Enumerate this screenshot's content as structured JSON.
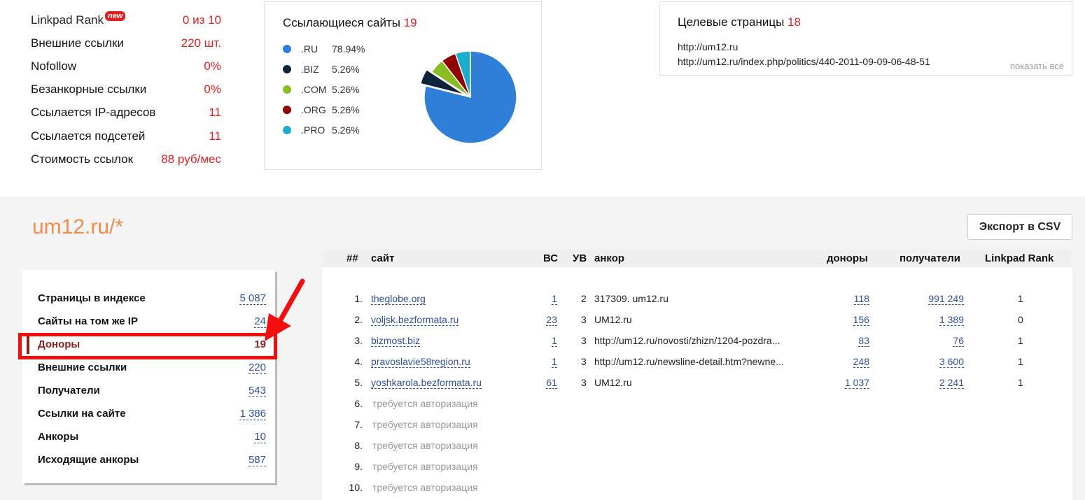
{
  "stats": [
    {
      "label": "Linkpad Rank",
      "badge": "new",
      "value": "0 из 10"
    },
    {
      "label": "Внешние ссылки",
      "value": "220 шт."
    },
    {
      "label": "Nofollow",
      "value": "0%"
    },
    {
      "label": "Безанкорные ссылки",
      "value": "0%"
    },
    {
      "label": "Ссылается IP-адресов",
      "value": "11"
    },
    {
      "label": "Ссылается подсетей",
      "value": "11"
    },
    {
      "label": "Стоимость ссылок",
      "value": "88 руб/мес"
    }
  ],
  "referring": {
    "title": "Ссылающиеся сайты",
    "count": "19",
    "legend": [
      {
        "name": ".RU",
        "value": "78.94%",
        "color": "#2f7ed8"
      },
      {
        "name": ".BIZ",
        "value": "5.26%",
        "color": "#0d233a"
      },
      {
        "name": ".COM",
        "value": "5.26%",
        "color": "#8bbc21"
      },
      {
        "name": ".ORG",
        "value": "5.26%",
        "color": "#910000"
      },
      {
        "name": ".PRO",
        "value": "5.26%",
        "color": "#1aadce"
      }
    ]
  },
  "target": {
    "title": "Целевые страницы",
    "count": "18",
    "urls": [
      "http://um12.ru",
      "http://um12.ru/index.php/politics/440-2011-09-09-06-48-51"
    ],
    "show_all": "показать все"
  },
  "site_title": "um12.ru/*",
  "export_label": "Экспорт в CSV",
  "menu": [
    {
      "label": "Страницы в индексе",
      "count": "5 087"
    },
    {
      "label": "Сайты на том же IP",
      "count": "24"
    },
    {
      "label": "Доноры",
      "count": "19"
    },
    {
      "label": "Внешние ссылки",
      "count": "220"
    },
    {
      "label": "Получатели",
      "count": "543"
    },
    {
      "label": "Ссылки на сайте",
      "count": "1 386"
    },
    {
      "label": "Анкоры",
      "count": "10"
    },
    {
      "label": "Исходящие анкоры",
      "count": "587"
    }
  ],
  "table": {
    "headers": {
      "num": "##",
      "site": "сайт",
      "bc": "ВС",
      "uv": "УВ",
      "anchor": "анкор",
      "donors": "доноры",
      "recipients": "получатели",
      "rank": "Linkpad Rank"
    },
    "rows": [
      {
        "num": "1.",
        "site": "theglobe.org",
        "bc": "1",
        "uv": "2",
        "anchor": "317309. um12.ru",
        "donors": "118",
        "recipients": "991 249",
        "rank": "1"
      },
      {
        "num": "2.",
        "site": "voljsk.bezformata.ru",
        "bc": "23",
        "uv": "3",
        "anchor": "UM12.ru",
        "donors": "156",
        "recipients": "1 389",
        "rank": "0"
      },
      {
        "num": "3.",
        "site": "bizmost.biz",
        "bc": "1",
        "uv": "3",
        "anchor": "http://um12.ru/novosti/zhizn/1204-pozdra...",
        "donors": "83",
        "recipients": "76",
        "rank": "1"
      },
      {
        "num": "4.",
        "site": "pravoslavie58region.ru",
        "bc": "1",
        "uv": "3",
        "anchor": "http://um12.ru/newsline-detail.htm?newne...",
        "donors": "248",
        "recipients": "3 600",
        "rank": "1"
      },
      {
        "num": "5.",
        "site": "yoshkarola.bezformata.ru",
        "bc": "61",
        "uv": "3",
        "anchor": "UM12.ru",
        "donors": "1 037",
        "recipients": "2 241",
        "rank": "1"
      }
    ],
    "locked_rows": [
      {
        "num": "6.",
        "text": "требуется авторизация"
      },
      {
        "num": "7.",
        "text": "требуется авторизация"
      },
      {
        "num": "8.",
        "text": "требуется авторизация"
      },
      {
        "num": "9.",
        "text": "требуется авторизация"
      },
      {
        "num": "10.",
        "text": "требуется авторизация"
      }
    ]
  }
}
